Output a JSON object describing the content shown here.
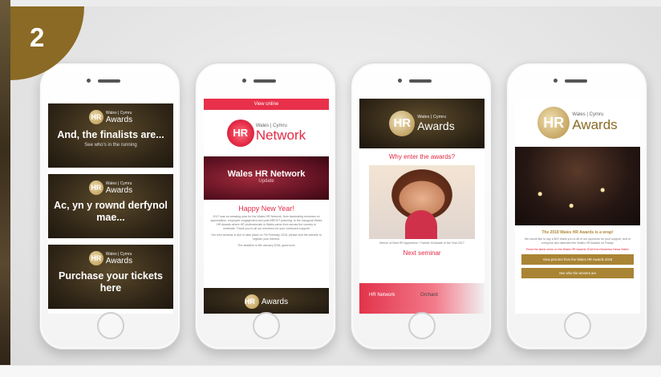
{
  "step": {
    "number": "2"
  },
  "phone1": {
    "banners": [
      {
        "logo_text": "HR",
        "logo_small": "Wales | Cymru",
        "logo_awards": "Awards",
        "headline": "And, the finalists are...",
        "sub": "See who's in the running"
      },
      {
        "logo_text": "HR",
        "logo_small": "Wales | Cymru",
        "logo_awards": "Awards",
        "headline": "Ac, yn y rownd derfynol mae...",
        "sub": ""
      },
      {
        "logo_text": "HR",
        "logo_small": "Wales | Cymru",
        "logo_awards": "Awards",
        "headline": "Purchase your tickets here",
        "sub": ""
      }
    ]
  },
  "phone2": {
    "top_bar": "View online",
    "logo_ring": "HR",
    "logo_small": "Wales | Cymru",
    "logo_big": "Network",
    "banner_title": "Wales HR Network",
    "banner_sub": "Update",
    "heading": "Happy New Year!",
    "paragraph1": "2017 was an amazing year for the Wales HR Network, from fascinating seminars on appreciation, employee engagement and post BREXIT planning, to the inaugural Wales HR Awards where HR professionals in Wales came from across the country to celebrate. Thank you to all our members for your continued support!",
    "paragraph2": "Our next seminar is due to take place on 7th February 2018, please visit the website to register your interest.",
    "paragraph3": "The deadline is 8th January 2018, good luck!",
    "footer_logo": "HR",
    "footer_awards": "Awards"
  },
  "phone3": {
    "logo_disc": "HR",
    "logo_small": "Wales | Cymru",
    "logo_big": "Awards",
    "heading": "Why enter the awards?",
    "caption": "Winner of Best HR Apprentice / Trainee Graduate of the Year 2017",
    "seminar": "Next seminar",
    "seminar_logo": "HR Network",
    "seminar_brand": "Orchard"
  },
  "phone4": {
    "logo_disc": "HR",
    "logo_small": "Wales | Cymru",
    "logo_big": "Awards",
    "heading": "The 2018 Wales HR Awards is a wrap!",
    "paragraph": "We would like to say a BIG thank you to all of our sponsors for your support, and to everyone who attended the Wales HR Awards on Friday!",
    "link": "Read the latest news on the Wales HR Awards 2018 from Business News Wales",
    "button1": "View pictures from the Wales HR Awards 2018",
    "button2": "See who the winners are"
  }
}
